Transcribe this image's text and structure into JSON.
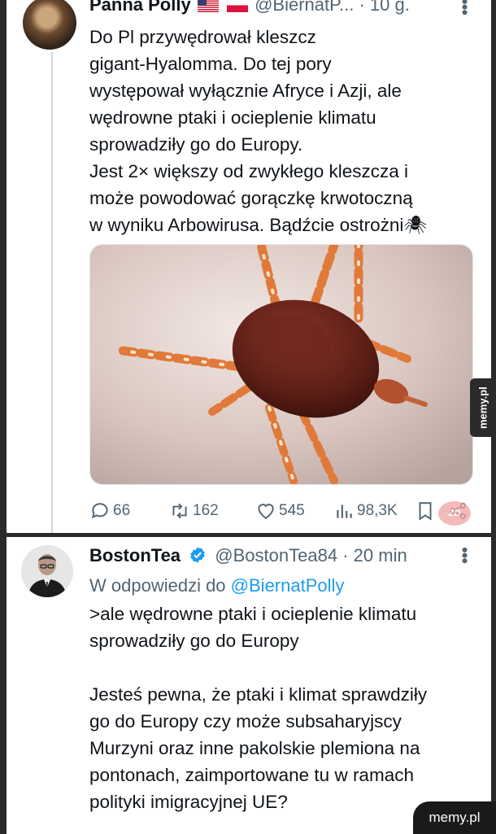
{
  "tweet1": {
    "author_name": "Panna Polly",
    "handle": "@BiernatP...",
    "separator": "·",
    "time": "10 g.",
    "text": "Do Pl przywędrował kleszcz\ngigant-Hyalomma. Do tej pory\nwystępował wyłącznie Afryce i Azji, ale\nwędrowne ptaki i ocieplenie klimatu\nsprowadziły go do Europy.\nJest 2× większy od zwykłego kleszcza i\nmoże powodować gorączkę krwotoczną\nw wyniku Arbowirusa. Bądźcie ostrożni🕷",
    "icons": [
      "us-flag",
      "poland-flag",
      "more-icon"
    ],
    "actions": {
      "replies": "66",
      "retweets": "162",
      "likes": "545",
      "views": "98,3K"
    }
  },
  "tweet2": {
    "author_name": "BostonTea",
    "handle": "@BostonTea84",
    "separator": "·",
    "time": "20 min",
    "reply_prefix": "W odpowiedzi do",
    "reply_mention": "@BiernatPolly",
    "text": ">ale wędrowne ptaki i ocieplenie klimatu\nsprowadziły go do Europy\n\nJesteś pewna, że ptaki i klimat sprawdziły\ngo do Europy czy może subsaharyjscy\nMurzyni oraz inne pakolskie plemiona na\npontonach, zaimportowane tu w ramach\npolityki imigracyjnej UE?"
  },
  "watermarks": {
    "side": "memy.pl",
    "corner": "memy.pl"
  },
  "colors": {
    "accent": "#1d9bf0",
    "secondary_text": "#536471",
    "thread_line": "#cfd9de"
  }
}
